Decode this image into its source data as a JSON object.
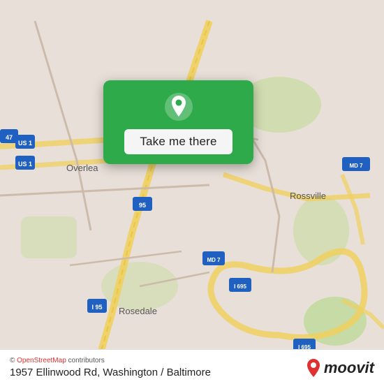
{
  "map": {
    "background_color": "#e8e0d8",
    "center_lat": 39.335,
    "center_lng": -76.51
  },
  "popup": {
    "take_me_there_label": "Take me there",
    "pin_color": "#ffffff"
  },
  "bottom_bar": {
    "osm_prefix": "© ",
    "osm_link_text": "OpenStreetMap",
    "osm_suffix": " contributors",
    "address": "1957 Ellinwood Rd, Washington / Baltimore",
    "moovit_logo_text": "moovit"
  }
}
